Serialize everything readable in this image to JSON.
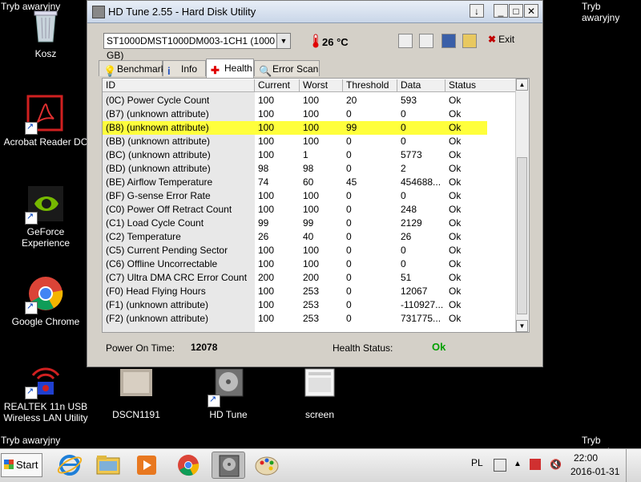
{
  "desktop": {
    "safe_mode_label": "Tryb awaryjny",
    "icons": [
      {
        "name": "recycle-bin",
        "label": "Kosz"
      },
      {
        "name": "acrobat-reader",
        "label": "Acrobat Reader DC"
      },
      {
        "name": "geforce-experience",
        "label": "GeForce Experience"
      },
      {
        "name": "google-chrome",
        "label": "Google Chrome"
      },
      {
        "name": "realtek-wlan",
        "label": "REALTEK 11n USB Wireless LAN Utility"
      },
      {
        "name": "dscn1191",
        "label": "DSCN1191"
      },
      {
        "name": "hd-tune",
        "label": "HD Tune"
      },
      {
        "name": "screen",
        "label": "screen"
      }
    ]
  },
  "window": {
    "title": "HD Tune 2.55 - Hard Disk Utility",
    "drive": "ST1000DMST1000DM003-1CH1 (1000 GB)",
    "temperature": "26 °C",
    "exit_label": "Exit",
    "tabs": [
      {
        "label": "Benchmark",
        "icon": "benchmark-icon",
        "active": false
      },
      {
        "label": "Info",
        "icon": "info-icon",
        "active": false
      },
      {
        "label": "Health",
        "icon": "health-icon",
        "active": true
      },
      {
        "label": "Error Scan",
        "icon": "error-scan-icon",
        "active": false
      }
    ],
    "columns": [
      "ID",
      "Current",
      "Worst",
      "Threshold",
      "Data",
      "Status"
    ],
    "rows": [
      [
        "(0C) Power Cycle Count",
        "100",
        "100",
        "20",
        "593",
        "Ok"
      ],
      [
        "(B7) (unknown attribute)",
        "100",
        "100",
        "0",
        "0",
        "Ok"
      ],
      [
        "(B8) (unknown attribute)",
        "100",
        "100",
        "99",
        "0",
        "Ok"
      ],
      [
        "(BB) (unknown attribute)",
        "100",
        "100",
        "0",
        "0",
        "Ok"
      ],
      [
        "(BC) (unknown attribute)",
        "100",
        "1",
        "0",
        "5773",
        "Ok"
      ],
      [
        "(BD) (unknown attribute)",
        "98",
        "98",
        "0",
        "2",
        "Ok"
      ],
      [
        "(BE) Airflow Temperature",
        "74",
        "60",
        "45",
        "454688...",
        "Ok"
      ],
      [
        "(BF) G-sense Error Rate",
        "100",
        "100",
        "0",
        "0",
        "Ok"
      ],
      [
        "(C0) Power Off Retract Count",
        "100",
        "100",
        "0",
        "248",
        "Ok"
      ],
      [
        "(C1) Load Cycle Count",
        "99",
        "99",
        "0",
        "2129",
        "Ok"
      ],
      [
        "(C2) Temperature",
        "26",
        "40",
        "0",
        "26",
        "Ok"
      ],
      [
        "(C5) Current Pending Sector",
        "100",
        "100",
        "0",
        "0",
        "Ok"
      ],
      [
        "(C6) Offline Uncorrectable",
        "100",
        "100",
        "0",
        "0",
        "Ok"
      ],
      [
        "(C7) Ultra DMA CRC Error Count",
        "200",
        "200",
        "0",
        "51",
        "Ok"
      ],
      [
        "(F0) Head Flying Hours",
        "100",
        "253",
        "0",
        "12067",
        "Ok"
      ],
      [
        "(F1) (unknown attribute)",
        "100",
        "253",
        "0",
        "-110927...",
        "Ok"
      ],
      [
        "(F2) (unknown attribute)",
        "100",
        "253",
        "0",
        "731775...",
        "Ok"
      ]
    ],
    "highlighted_row": 2,
    "power_on_label": "Power On Time:",
    "power_on_value": "12078",
    "health_label": "Health Status:",
    "health_value": "Ok"
  },
  "taskbar": {
    "start_label": "Start",
    "lang": "PL",
    "time": "22:00",
    "date": "2016-01-31"
  },
  "colors": {
    "highlight": "#ffff3c",
    "health_ok": "#00a000"
  }
}
